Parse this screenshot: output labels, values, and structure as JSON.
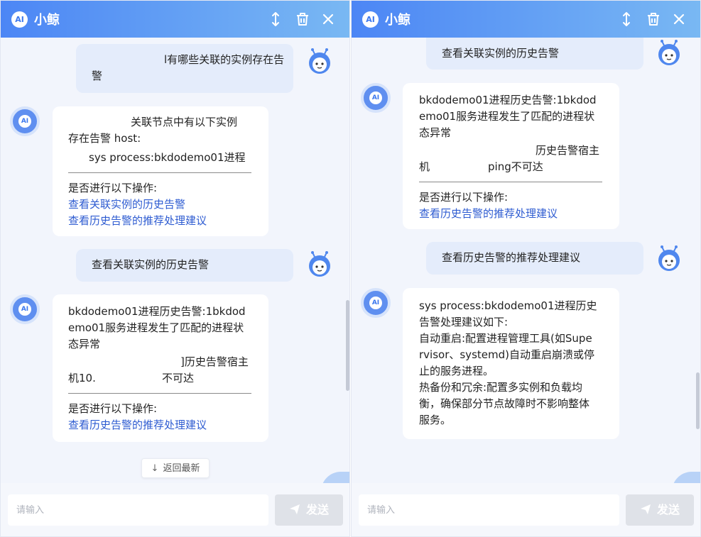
{
  "app": {
    "title": "小鲸",
    "logo_text": "AI",
    "avatar_text": "AI"
  },
  "icons": {
    "resize": "vertical-resize-icon",
    "clear": "trash-icon",
    "close": "close-icon",
    "send": "paper-plane-icon",
    "back": "arrow-down-icon",
    "user_avatar": "robot-mascot-avatar"
  },
  "colors": {
    "header_start": "#4c86f5",
    "header_end": "#79b8f3",
    "link": "#2d5bd1",
    "user_bubble": "#e4ecfb"
  },
  "left": {
    "messages": [
      {
        "lines": [
          "l有哪些关联的实例存在告",
          "警"
        ]
      },
      {
        "lines": [
          "关联节点中有以下实例",
          "存在告警 host:",
          "sys process:bkdodemo01进程"
        ],
        "prompt": "是否进行以下操作:",
        "actions": [
          "查看关联实例的历史告警",
          "查看历史告警的推荐处理建议"
        ]
      },
      {
        "lines": [
          "查看关联实例的历史告警"
        ]
      },
      {
        "lines": [
          "bkdodemo01进程历史告警:1bkdod",
          "emo01服务进程发生了匹配的进程状",
          "态异常",
          "]历史告警宿主",
          "机10.",
          "不可达"
        ],
        "prompt": "是否进行以下操作:",
        "actions": [
          "查看历史告警的推荐处理建议"
        ]
      }
    ],
    "back_to_latest": "返回最新",
    "input_placeholder": "请输入",
    "send_label": "发送"
  },
  "right": {
    "messages": [
      {
        "lines": [
          "查看关联实例的历史告警"
        ]
      },
      {
        "lines": [
          "bkdodemo01进程历史告警:1bkdod",
          "emo01服务进程发生了匹配的进程状",
          "态异常",
          "历史告警宿主",
          "机",
          "ping不可达"
        ],
        "prompt": "是否进行以下操作:",
        "actions": [
          "查看历史告警的推荐处理建议"
        ]
      },
      {
        "lines": [
          "查看历史告警的推荐处理建议"
        ]
      },
      {
        "lines": [
          "sys process:bkdodemo01进程历史",
          "告警处理建议如下:",
          "自动重启:配置进程管理工具(如Supe",
          "rvisor、systemd)自动重启崩溃或停",
          "止的服务进程。",
          "热备份和冗余:配置多实例和负载均",
          "衡，确保部分节点故障时不影响整体",
          "服务。"
        ]
      }
    ],
    "input_placeholder": "请输入",
    "send_label": "发送"
  }
}
